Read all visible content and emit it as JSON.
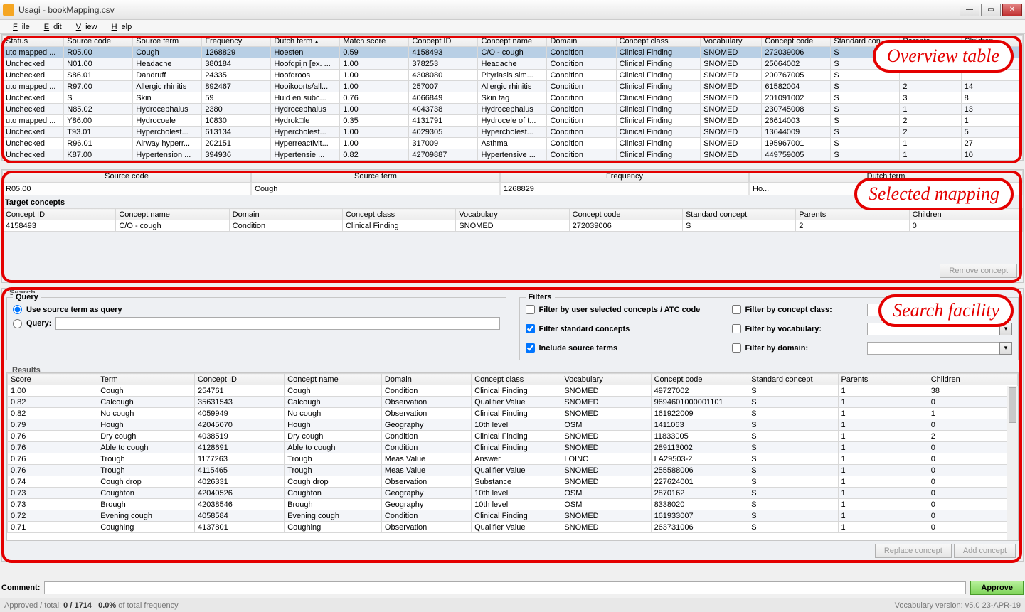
{
  "window": {
    "title": "Usagi - bookMapping.csv"
  },
  "menu": {
    "file": "File",
    "edit": "Edit",
    "view": "View",
    "help": "Help"
  },
  "callouts": {
    "overview": "Overview table",
    "selmap": "Selected mapping",
    "search": "Search facility"
  },
  "overview": {
    "headers": [
      "Status",
      "Source code",
      "Source term",
      "Frequency",
      "Dutch term",
      "Match score",
      "Concept ID",
      "Concept name",
      "Domain",
      "Concept class",
      "Vocabulary",
      "Concept code",
      "Standard con...",
      "Parents",
      "Children"
    ],
    "sort_col": 4,
    "rows": [
      {
        "sel": true,
        "cells": [
          "uto mapped ...",
          "R05.00",
          "Cough",
          "1268829",
          "Hoesten",
          "0.59",
          "4158493",
          "C/O - cough",
          "Condition",
          "Clinical Finding",
          "SNOMED",
          "272039006",
          "S",
          "",
          ""
        ]
      },
      {
        "cells": [
          "Unchecked",
          "N01.00",
          "Headache",
          "380184",
          "Hoofdpijn [ex. ...",
          "1.00",
          "378253",
          "Headache",
          "Condition",
          "Clinical Finding",
          "SNOMED",
          "25064002",
          "S",
          "",
          ""
        ]
      },
      {
        "cells": [
          "Unchecked",
          "S86.01",
          "Dandruff",
          "24335",
          "Hoofdroos",
          "1.00",
          "4308080",
          "Pityriasis sim...",
          "Condition",
          "Clinical Finding",
          "SNOMED",
          "200767005",
          "S",
          "",
          ""
        ]
      },
      {
        "cells": [
          "uto mapped ...",
          "R97.00",
          "Allergic rhinitis",
          "892467",
          "Hooikoorts/all...",
          "1.00",
          "257007",
          "Allergic rhinitis",
          "Condition",
          "Clinical Finding",
          "SNOMED",
          "61582004",
          "S",
          "2",
          "14"
        ]
      },
      {
        "cells": [
          "Unchecked",
          "S",
          "Skin",
          "59",
          "Huid en subc...",
          "0.76",
          "4066849",
          "Skin tag",
          "Condition",
          "Clinical Finding",
          "SNOMED",
          "201091002",
          "S",
          "3",
          "8"
        ]
      },
      {
        "cells": [
          "Unchecked",
          "N85.02",
          "Hydrocephalus",
          "2380",
          "Hydrocephalus",
          "1.00",
          "4043738",
          "Hydrocephalus",
          "Condition",
          "Clinical Finding",
          "SNOMED",
          "230745008",
          "S",
          "1",
          "13"
        ]
      },
      {
        "cells": [
          "uto mapped ...",
          "Y86.00",
          "Hydrocoele",
          "10830",
          "Hydrok□le",
          "0.35",
          "4131791",
          "Hydrocele of t...",
          "Condition",
          "Clinical Finding",
          "SNOMED",
          "26614003",
          "S",
          "2",
          "1"
        ]
      },
      {
        "cells": [
          "Unchecked",
          "T93.01",
          "Hypercholest...",
          "613134",
          "Hypercholest...",
          "1.00",
          "4029305",
          "Hypercholest...",
          "Condition",
          "Clinical Finding",
          "SNOMED",
          "13644009",
          "S",
          "2",
          "5"
        ]
      },
      {
        "cells": [
          "Unchecked",
          "R96.01",
          "Airway hyperr...",
          "202151",
          "Hyperreactivit...",
          "1.00",
          "317009",
          "Asthma",
          "Condition",
          "Clinical Finding",
          "SNOMED",
          "195967001",
          "S",
          "1",
          "27"
        ]
      },
      {
        "cells": [
          "Unchecked",
          "K87.00",
          "Hypertension ...",
          "394936",
          "Hypertensie ...",
          "0.82",
          "42709887",
          "Hypertensive ...",
          "Condition",
          "Clinical Finding",
          "SNOMED",
          "449759005",
          "S",
          "1",
          "10"
        ]
      }
    ]
  },
  "selected": {
    "src_headers": [
      "Source code",
      "Source term",
      "Frequency",
      "Dutch term"
    ],
    "src_values": [
      "R05.00",
      "Cough",
      "1268829",
      "Ho..."
    ],
    "tc_label": "Target concepts",
    "tc_headers": [
      "Concept ID",
      "Concept name",
      "Domain",
      "Concept class",
      "Vocabulary",
      "Concept code",
      "Standard concept",
      "Parents",
      "Children"
    ],
    "tc_row": [
      "4158493",
      "C/O - cough",
      "Condition",
      "Clinical Finding",
      "SNOMED",
      "272039006",
      "S",
      "2",
      "0"
    ],
    "remove_btn": "Remove concept"
  },
  "search": {
    "search_label": "Search",
    "query_legend": "Query",
    "use_source_label": "Use source term as query",
    "query_label": "Query:",
    "query_value": "",
    "filters_legend": "Filters",
    "f_user": "Filter by user selected concepts / ATC code",
    "f_std": "Filter standard concepts",
    "f_inc": "Include source terms",
    "f_class": "Filter by concept class:",
    "f_vocab": "Filter by vocabulary:",
    "f_domain": "Filter by domain:",
    "results_label": "Results",
    "res_headers": [
      "Score",
      "Term",
      "Concept ID",
      "Concept name",
      "Domain",
      "Concept class",
      "Vocabulary",
      "Concept code",
      "Standard concept",
      "Parents",
      "Children"
    ],
    "res_rows": [
      [
        "1.00",
        "Cough",
        "254761",
        "Cough",
        "Condition",
        "Clinical Finding",
        "SNOMED",
        "49727002",
        "S",
        "1",
        "38"
      ],
      [
        "0.82",
        "Calcough",
        "35631543",
        "Calcough",
        "Observation",
        "Qualifier Value",
        "SNOMED",
        "9694601000001101",
        "S",
        "1",
        "0"
      ],
      [
        "0.82",
        "No cough",
        "4059949",
        "No cough",
        "Observation",
        "Clinical Finding",
        "SNOMED",
        "161922009",
        "S",
        "1",
        "1"
      ],
      [
        "0.79",
        "Hough",
        "42045070",
        "Hough",
        "Geography",
        "10th level",
        "OSM",
        "1411063",
        "S",
        "1",
        "0"
      ],
      [
        "0.76",
        "Dry cough",
        "4038519",
        "Dry cough",
        "Condition",
        "Clinical Finding",
        "SNOMED",
        "11833005",
        "S",
        "1",
        "2"
      ],
      [
        "0.76",
        "Able to cough",
        "4128691",
        "Able to cough",
        "Condition",
        "Clinical Finding",
        "SNOMED",
        "289113002",
        "S",
        "1",
        "0"
      ],
      [
        "0.76",
        "Trough",
        "1177263",
        "Trough",
        "Meas Value",
        "Answer",
        "LOINC",
        "LA29503-2",
        "S",
        "1",
        "0"
      ],
      [
        "0.76",
        "Trough",
        "4115465",
        "Trough",
        "Meas Value",
        "Qualifier Value",
        "SNOMED",
        "255588006",
        "S",
        "1",
        "0"
      ],
      [
        "0.74",
        "Cough drop",
        "4026331",
        "Cough drop",
        "Observation",
        "Substance",
        "SNOMED",
        "227624001",
        "S",
        "1",
        "0"
      ],
      [
        "0.73",
        "Coughton",
        "42040526",
        "Coughton",
        "Geography",
        "10th level",
        "OSM",
        "2870162",
        "S",
        "1",
        "0"
      ],
      [
        "0.73",
        "Brough",
        "42038546",
        "Brough",
        "Geography",
        "10th level",
        "OSM",
        "8338020",
        "S",
        "1",
        "0"
      ],
      [
        "0.72",
        "Evening cough",
        "4058584",
        "Evening cough",
        "Condition",
        "Clinical Finding",
        "SNOMED",
        "161933007",
        "S",
        "1",
        "0"
      ],
      [
        "0.71",
        "Coughing",
        "4137801",
        "Coughing",
        "Observation",
        "Qualifier Value",
        "SNOMED",
        "263731006",
        "S",
        "1",
        "0"
      ]
    ],
    "replace_btn": "Replace concept",
    "add_btn": "Add concept"
  },
  "footer": {
    "comment_label": "Comment:",
    "comment_value": "",
    "approve": "Approve",
    "status_left_a": "Approved / total: ",
    "status_left_b": "0 / 1714",
    "status_left_c": "0.0%",
    "status_left_d": " of total frequency",
    "status_right": "Vocabulary version: v5.0 23-APR-19"
  }
}
